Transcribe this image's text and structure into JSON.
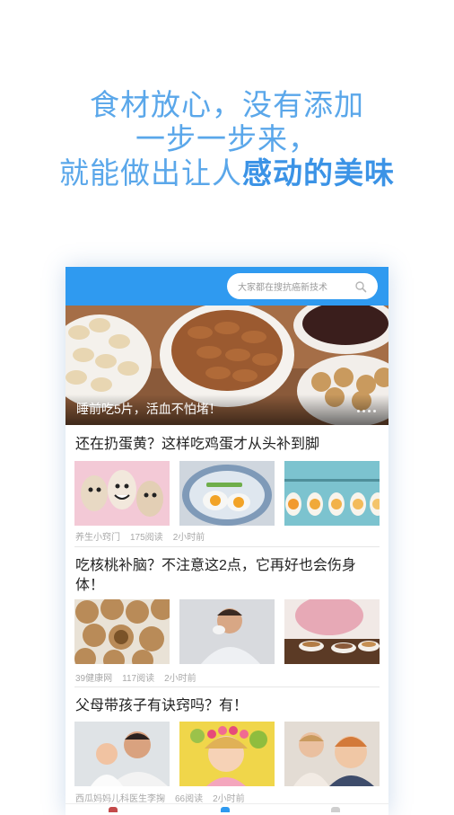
{
  "promo": {
    "line1": "食材放心，没有添加",
    "line2": "一步一步来，",
    "line3_prefix": "就能做出让人",
    "line3_highlight": "感动的美味"
  },
  "colors": {
    "brand_blue": "#2f9af0",
    "promo_text": "#5aa7ea",
    "promo_highlight": "#3b93e6"
  },
  "search": {
    "placeholder": "大家都在搜抗癌新技术",
    "icon": "search-icon"
  },
  "banner": {
    "title": "睡前吃5片，活血不怕堵！"
  },
  "articles": [
    {
      "title": "还在扔蛋黄？这样吃鸡蛋才从头补到脚",
      "source": "养生小窍门",
      "reads": "175阅读",
      "time": "2小时前"
    },
    {
      "title": "吃核桃补脑？不注意这2点，它再好也会伤身体！",
      "source": "39健康网",
      "reads": "117阅读",
      "time": "2小时前"
    },
    {
      "title": "父母带孩子有诀窍吗？有！",
      "source": "西瓜妈妈儿科医生李掬",
      "reads": "66阅读",
      "time": "2小时前"
    }
  ]
}
